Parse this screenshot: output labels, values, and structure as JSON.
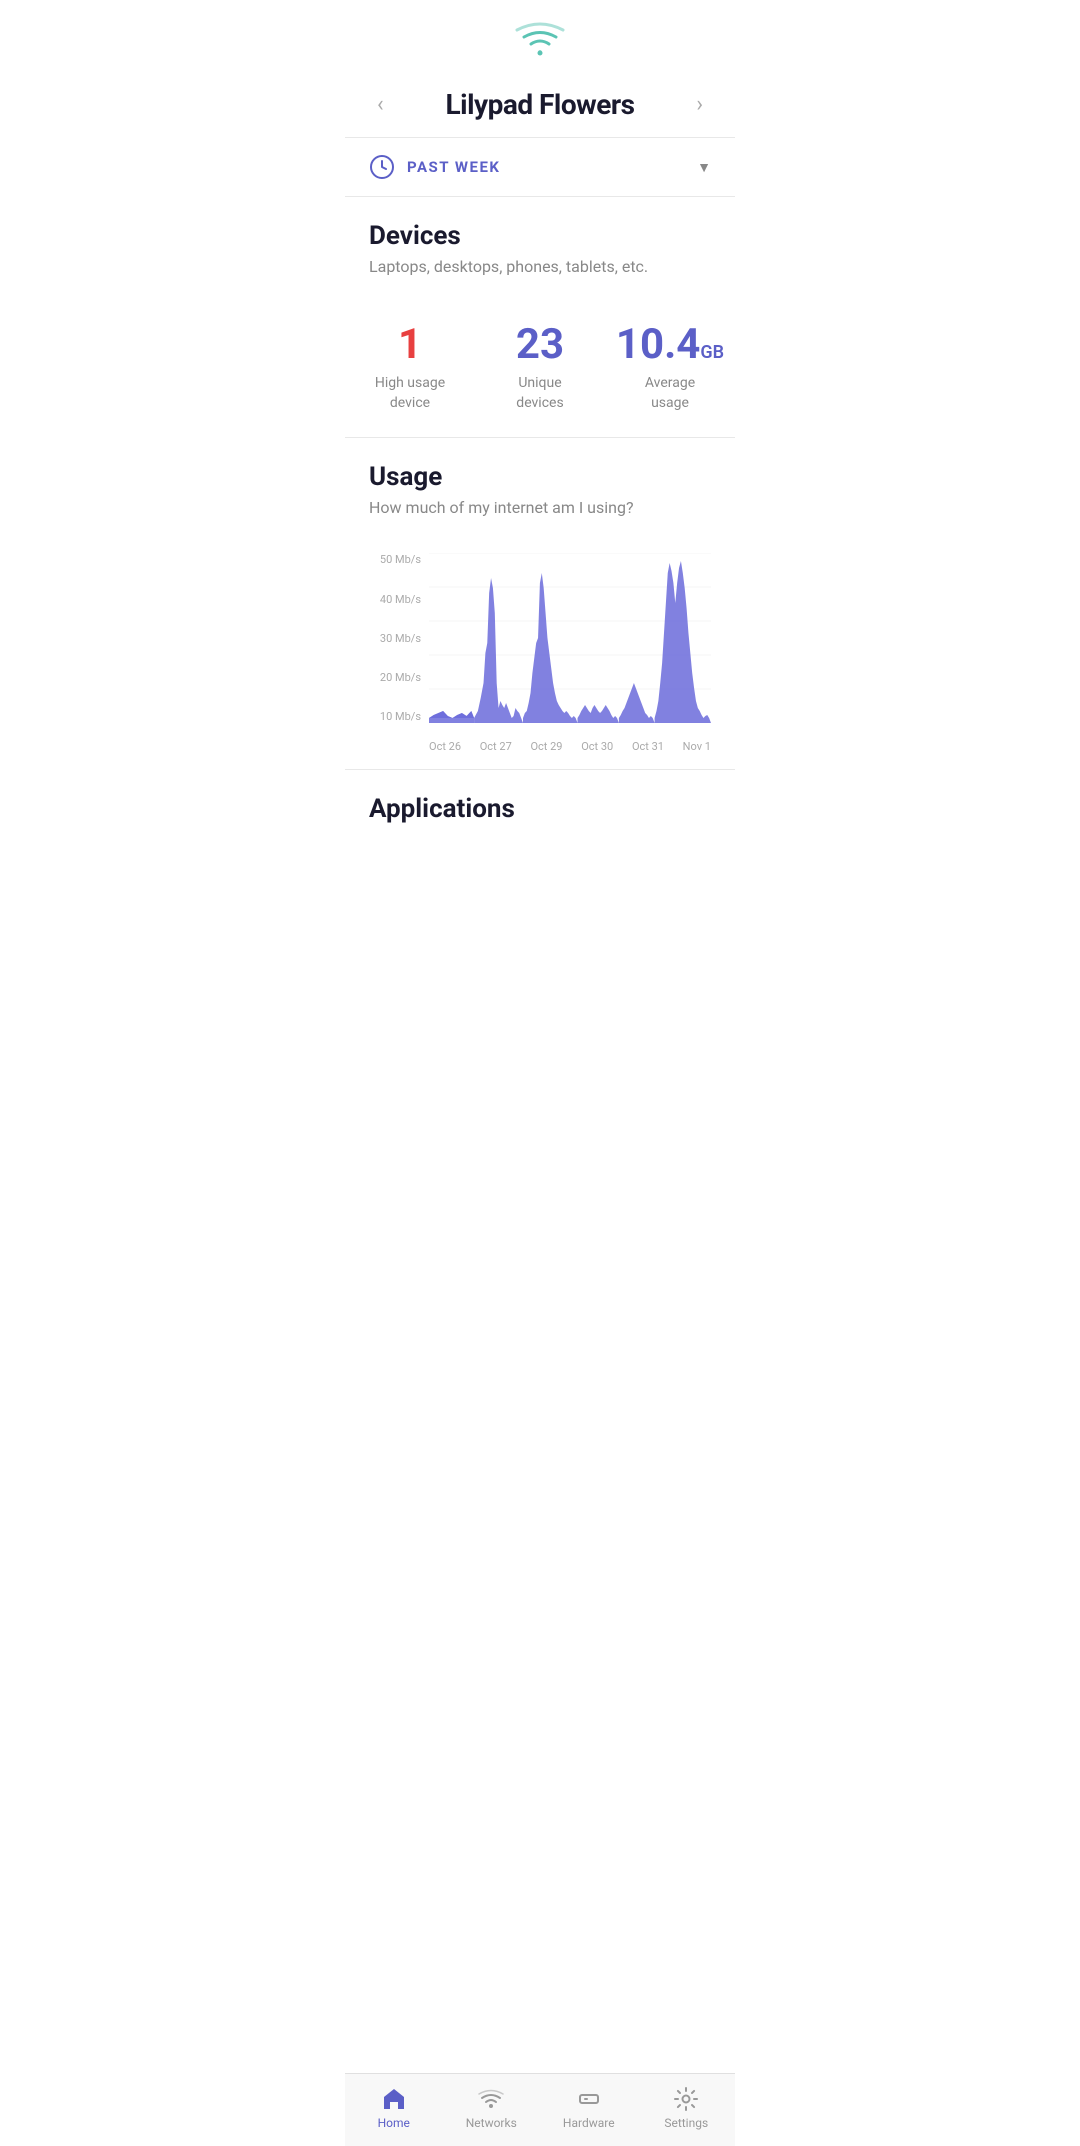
{
  "wifi_icon": "wifi",
  "header": {
    "title": "Lilypad Flowers",
    "prev_arrow": "‹",
    "next_arrow": "›"
  },
  "time_filter": {
    "label": "PAST WEEK",
    "icon": "clock"
  },
  "devices": {
    "section_title": "Devices",
    "section_subtitle": "Laptops, desktops, phones, tablets, etc.",
    "stats": [
      {
        "value": "1",
        "label": "High usage\ndevice",
        "color": "red"
      },
      {
        "value": "23",
        "label": "Unique\ndevices",
        "color": "purple"
      },
      {
        "value": "10.4",
        "unit": "GB",
        "label": "Average\nusage",
        "color": "purple"
      }
    ]
  },
  "usage": {
    "section_title": "Usage",
    "section_subtitle": "How much of my internet am I using?",
    "y_labels": [
      "50 Mb/s",
      "40 Mb/s",
      "30 Mb/s",
      "20 Mb/s",
      "10 Mb/s"
    ],
    "x_labels": [
      "Oct 26",
      "Oct 27",
      "Oct 29",
      "Oct 30",
      "Oct 31",
      "Nov 1"
    ]
  },
  "applications": {
    "section_title": "Applications"
  },
  "bottom_nav": [
    {
      "id": "home",
      "label": "Home",
      "active": true
    },
    {
      "id": "networks",
      "label": "Networks",
      "active": false
    },
    {
      "id": "hardware",
      "label": "Hardware",
      "active": false
    },
    {
      "id": "settings",
      "label": "Settings",
      "active": false
    }
  ]
}
